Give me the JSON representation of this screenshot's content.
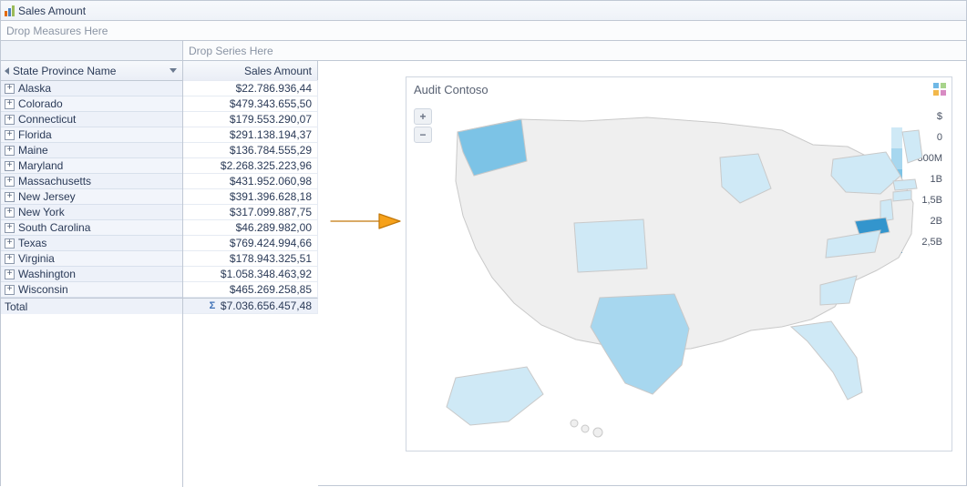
{
  "title": "Sales Amount",
  "drop_measures": "Drop Measures Here",
  "drop_series": "Drop Series Here",
  "row_header": "State Province Name",
  "value_header": "Sales Amount",
  "rows": [
    {
      "label": "Alaska",
      "value": "$22.786.936,44"
    },
    {
      "label": "Colorado",
      "value": "$479.343.655,50"
    },
    {
      "label": "Connecticut",
      "value": "$179.553.290,07"
    },
    {
      "label": "Florida",
      "value": "$291.138.194,37"
    },
    {
      "label": "Maine",
      "value": "$136.784.555,29"
    },
    {
      "label": "Maryland",
      "value": "$2.268.325.223,96"
    },
    {
      "label": "Massachusetts",
      "value": "$431.952.060,98"
    },
    {
      "label": "New Jersey",
      "value": "$391.396.628,18"
    },
    {
      "label": "New York",
      "value": "$317.099.887,75"
    },
    {
      "label": "South Carolina",
      "value": "$46.289.982,00"
    },
    {
      "label": "Texas",
      "value": "$769.424.994,66"
    },
    {
      "label": "Virginia",
      "value": "$178.943.325,51"
    },
    {
      "label": "Washington",
      "value": "$1.058.348.463,92"
    },
    {
      "label": "Wisconsin",
      "value": "$465.269.258,85"
    }
  ],
  "total_label": "Total",
  "total_value": "$7.036.656.457,48",
  "map": {
    "title": "Audit Contoso",
    "legend_title": "$",
    "legend_labels": [
      "0",
      "500M",
      "1B",
      "1,5B",
      "2B",
      "2,5B"
    ],
    "legend_colors": [
      "#cfe9f6",
      "#a7d7ef",
      "#7cc3e6",
      "#55aedb",
      "#3395cd",
      "#147cbe"
    ]
  },
  "chart_data": {
    "type": "choropleth",
    "title": "Audit Contoso",
    "unit": "$",
    "legend_breaks": [
      0,
      500000000,
      1000000000,
      1500000000,
      2000000000,
      2500000000
    ],
    "series": [
      {
        "state": "Alaska",
        "value": 22786936.44
      },
      {
        "state": "Colorado",
        "value": 479343655.5
      },
      {
        "state": "Connecticut",
        "value": 179553290.07
      },
      {
        "state": "Florida",
        "value": 291138194.37
      },
      {
        "state": "Maine",
        "value": 136784555.29
      },
      {
        "state": "Maryland",
        "value": 2268325223.96
      },
      {
        "state": "Massachusetts",
        "value": 431952060.98
      },
      {
        "state": "New Jersey",
        "value": 391396628.18
      },
      {
        "state": "New York",
        "value": 317099887.75
      },
      {
        "state": "South Carolina",
        "value": 46289982.0
      },
      {
        "state": "Texas",
        "value": 769424994.66
      },
      {
        "state": "Virginia",
        "value": 178943325.51
      },
      {
        "state": "Washington",
        "value": 1058348463.92
      },
      {
        "state": "Wisconsin",
        "value": 465269258.85
      }
    ]
  }
}
